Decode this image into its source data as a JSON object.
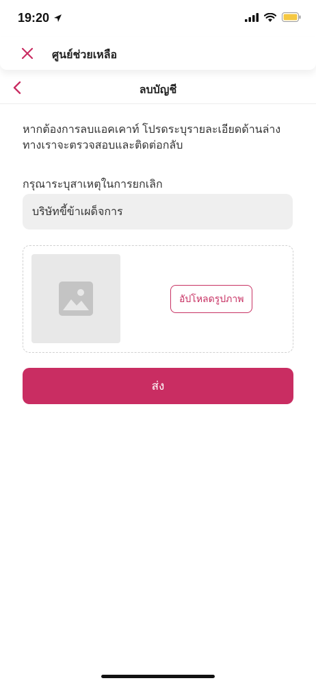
{
  "status_bar": {
    "time": "19:20",
    "battery_color": "#f5c842"
  },
  "sheet": {
    "title": "ศูนย์ช่วยเหลือ"
  },
  "nav": {
    "title": "ลบบัญชี"
  },
  "form": {
    "instructions": "หากต้องการลบแอคเคาท์ โปรดระบุรายละเอียดด้านล่าง ทางเราจะตรวจสอบและติดต่อกลับ",
    "reason_label": "กรุณาระบุสาเหตุในการยกเลิก",
    "reason_value": "บริษัทขี้ข้าเผด็จการ",
    "upload_label": "อัปโหลดรูปภาพ",
    "submit_label": "ส่ง"
  },
  "colors": {
    "accent": "#c92d62"
  }
}
